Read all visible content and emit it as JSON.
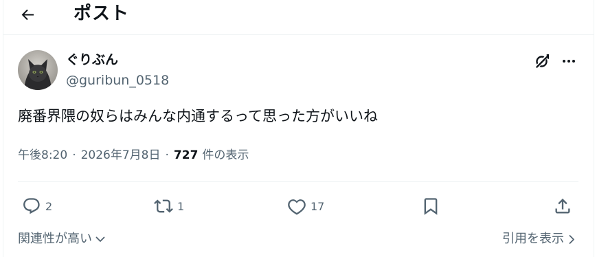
{
  "header": {
    "back_icon": "arrow-left-icon",
    "title": "ポスト"
  },
  "author": {
    "avatar_icon": "black-cat-avatar",
    "display_name": "ぐりぶん",
    "handle": "@guribun_0518"
  },
  "post": {
    "text": "廃番界隈の奴らはみんな内通するって思った方がいいね"
  },
  "meta": {
    "time": "午後8:20",
    "date": "2026年7月8日",
    "separator": "·",
    "views_count": "727",
    "views_label": "件の表示"
  },
  "actions": {
    "reply_count": "2",
    "repost_count": "1",
    "like_count": "17"
  },
  "footer": {
    "sort_label": "関連性が高い",
    "quotes_label": "引用を表示"
  },
  "colors": {
    "text": "#0f1419",
    "secondary": "#536471",
    "divider": "#eff3f4",
    "background": "#ffffff"
  }
}
